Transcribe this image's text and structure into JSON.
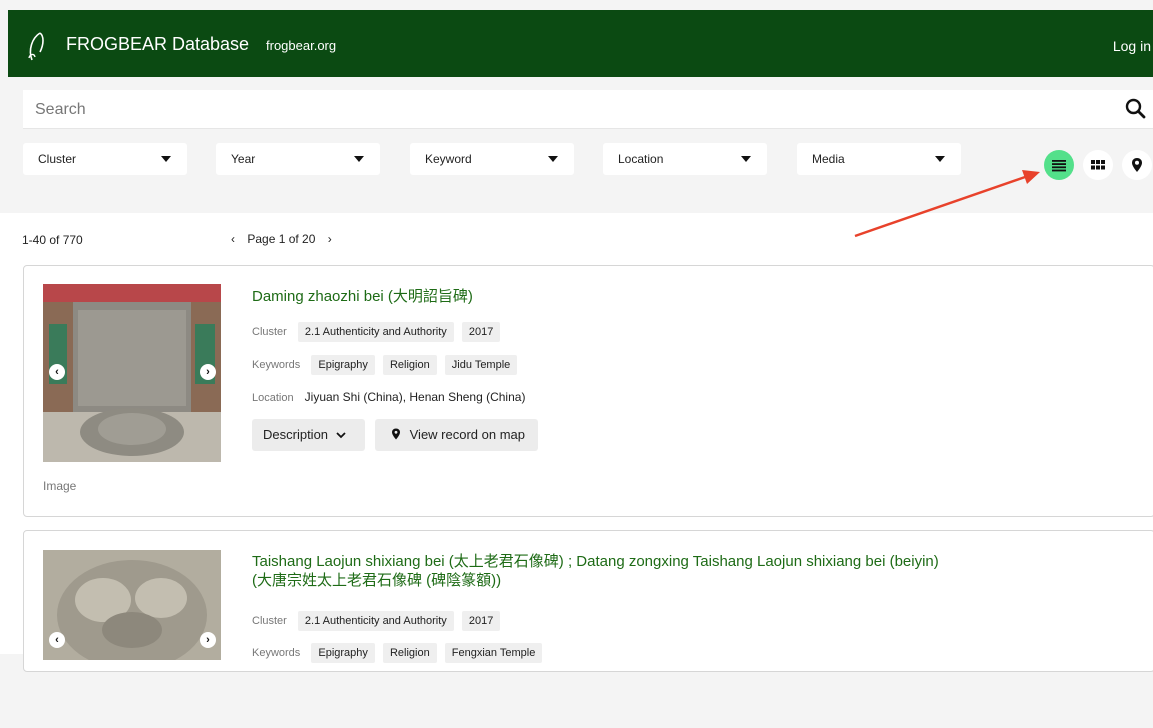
{
  "header": {
    "title": "FROGBEAR Database",
    "site_link": "frogbear.org",
    "login": "Log in",
    "bg_color": "#0b4a12"
  },
  "search": {
    "placeholder": "Search",
    "value": ""
  },
  "filters": [
    {
      "label": "Cluster"
    },
    {
      "label": "Year"
    },
    {
      "label": "Keyword"
    },
    {
      "label": "Location"
    },
    {
      "label": "Media"
    }
  ],
  "view_toggles": [
    {
      "icon": "list-icon",
      "active": true,
      "active_color": "#53e08a"
    },
    {
      "icon": "grid-icon",
      "active": false
    },
    {
      "icon": "map-pin-icon",
      "active": false
    }
  ],
  "results": {
    "count_text": "1-40 of 770",
    "page_text": "Page 1 of 20",
    "prev_symbol": "‹",
    "next_symbol": "›"
  },
  "records": [
    {
      "title": "Daming zhaozhi bei (大明詔旨碑)",
      "cluster_label": "Cluster",
      "cluster": "2.1 Authenticity and Authority",
      "year": "2017",
      "keywords_label": "Keywords",
      "keywords": [
        "Epigraphy",
        "Religion",
        "Jidu Temple"
      ],
      "location_label": "Location",
      "location": "Jiyuan Shi (China), Henan Sheng (China)",
      "description_btn": "Description",
      "map_btn": "View record on map",
      "media_caption": "Image"
    },
    {
      "title_line1": "Taishang Laojun shixiang bei (太上老君石像碑) ; Datang zongxing Taishang Laojun shixiang bei (beiyin)",
      "title_line2": "(大唐宗姓太上老君石像碑 (碑陰篆額))",
      "cluster_label": "Cluster",
      "cluster": "2.1 Authenticity and Authority",
      "year": "2017",
      "keywords_label": "Keywords",
      "keywords": [
        "Epigraphy",
        "Religion",
        "Fengxian Temple"
      ]
    }
  ]
}
